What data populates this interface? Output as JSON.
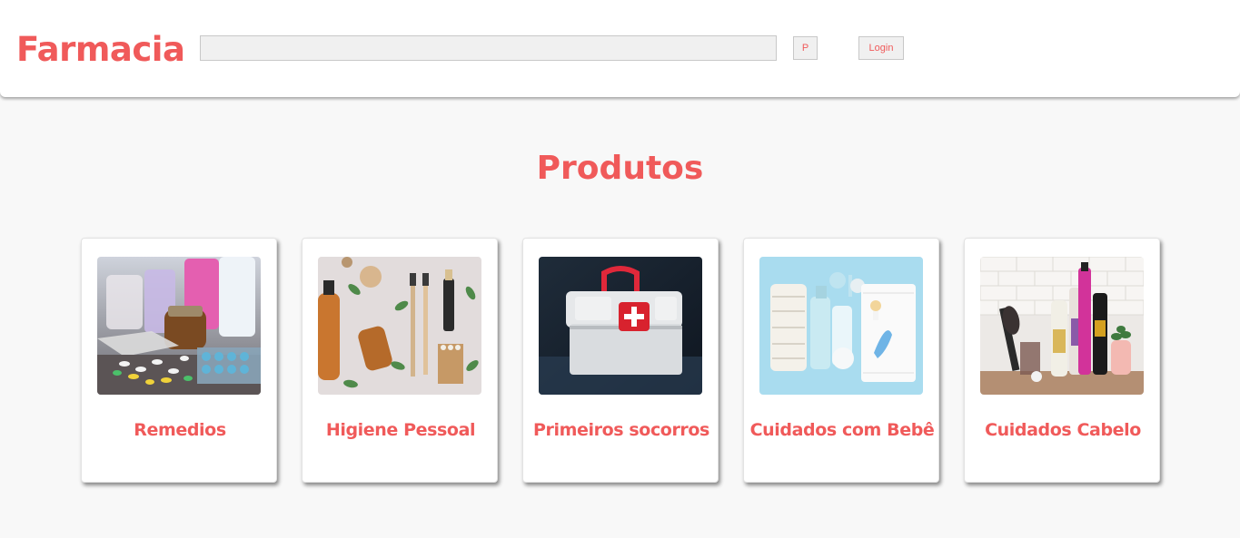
{
  "header": {
    "logo": "Farmacia",
    "search_value": "",
    "search_button": "P",
    "login_button": "Login"
  },
  "main": {
    "title": "Produtos",
    "categories": [
      {
        "label": "Remedios",
        "image": "pills-and-medicine-bottles"
      },
      {
        "label": "Higiene Pessoal",
        "image": "hygiene-products"
      },
      {
        "label": "Primeiros socorros",
        "image": "first-aid-kit"
      },
      {
        "label": "Cuidados com Bebê",
        "image": "baby-care-products"
      },
      {
        "label": "Cuidados Cabelo",
        "image": "hair-care-products"
      }
    ]
  },
  "colors": {
    "accent": "#f05a5a",
    "background": "#f8f8f8",
    "header_background": "#ffffff"
  }
}
